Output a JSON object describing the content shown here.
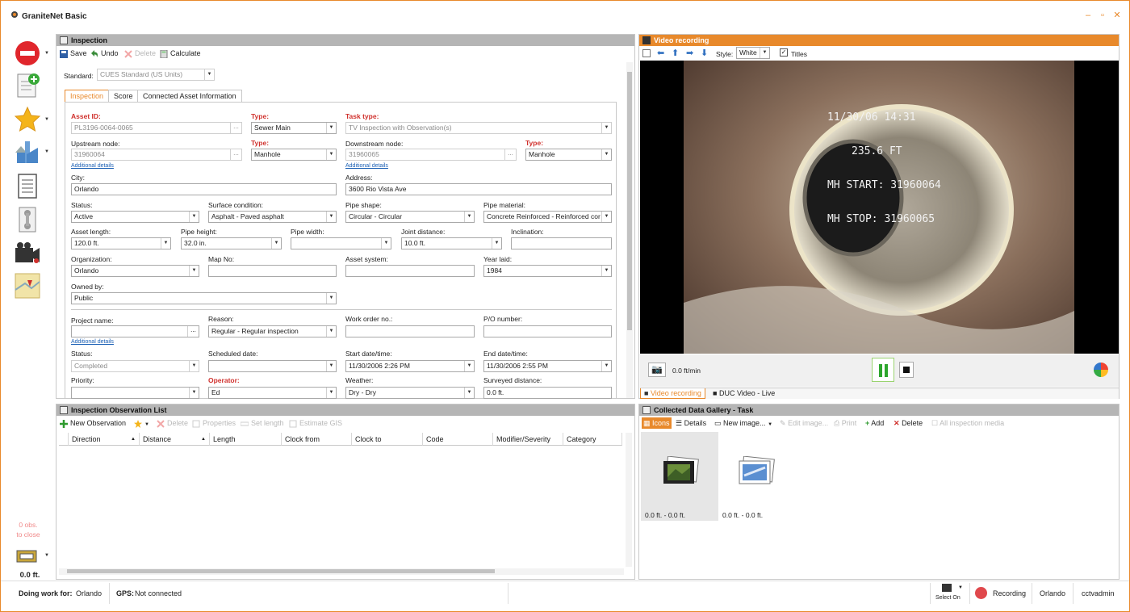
{
  "app": {
    "title": "GraniteNet Basic"
  },
  "leftbar": {
    "obs_count": "0 obs.",
    "obs_close": "to close",
    "distance": "0.0 ft."
  },
  "inspection": {
    "header": "Inspection",
    "toolbar": {
      "save": "Save",
      "undo": "Undo",
      "delete": "Delete",
      "calculate": "Calculate"
    },
    "standard_label": "Standard:",
    "standard_value": "CUES Standard (US Units)",
    "tabs": [
      "Inspection",
      "Score",
      "Connected Asset Information"
    ],
    "fields": {
      "asset_id_label": "Asset ID:",
      "asset_id": "PL3196-0064-0065",
      "type1_label": "Type:",
      "type1": "Sewer Main",
      "task_type_label": "Task type:",
      "task_type": "TV Inspection with Observation(s)",
      "upstream_label": "Upstream node:",
      "upstream": "31960064",
      "type2_label": "Type:",
      "type2": "Manhole",
      "downstream_label": "Downstream node:",
      "downstream": "31960065",
      "type3_label": "Type:",
      "type3": "Manhole",
      "additional_details": "Additional details",
      "city_label": "City:",
      "city": "Orlando",
      "address_label": "Address:",
      "address": "3600 Rio Vista Ave",
      "status_label": "Status:",
      "status": "Active",
      "surface_label": "Surface condition:",
      "surface": "Asphalt - Paved asphalt",
      "shape_label": "Pipe shape:",
      "shape": "Circular - Circular",
      "material_label": "Pipe material:",
      "material": "Concrete Reinforced - Reinforced cor",
      "length_label": "Asset length:",
      "length": "120.0 ft.",
      "height_label": "Pipe height:",
      "height": "32.0 in.",
      "width_label": "Pipe width:",
      "width": "",
      "joint_label": "Joint distance:",
      "joint": "10.0 ft.",
      "inclination_label": "Inclination:",
      "inclination": "",
      "org_label": "Organization:",
      "org": "Orlando",
      "mapno_label": "Map No:",
      "mapno": "",
      "asset_system_label": "Asset system:",
      "asset_system": "",
      "year_label": "Year laid:",
      "year": "1984",
      "owned_label": "Owned by:",
      "owned": "Public",
      "project_label": "Project name:",
      "project": "",
      "reason_label": "Reason:",
      "reason": "Regular - Regular inspection",
      "workorder_label": "Work order no.:",
      "workorder": "",
      "po_label": "P/O number:",
      "po": "",
      "status2_label": "Status:",
      "status2": "Completed",
      "scheduled_label": "Scheduled date:",
      "scheduled": "",
      "start_label": "Start date/time:",
      "start": "11/30/2006 2:26 PM",
      "end_label": "End date/time:",
      "end": "11/30/2006 2:55 PM",
      "priority_label": "Priority:",
      "priority": "",
      "operator_label": "Operator:",
      "operator": "Ed",
      "weather_label": "Weather:",
      "weather": "Dry - Dry",
      "surveyed_label": "Surveyed distance:",
      "surveyed": "0.0 ft."
    }
  },
  "observations": {
    "header": "Inspection Observation List",
    "toolbar": {
      "new": "New Observation",
      "delete": "Delete",
      "properties": "Properties",
      "set_length": "Set length",
      "estimate_gis": "Estimate GIS"
    },
    "columns": [
      "Direction",
      "Distance",
      "Length",
      "Clock from",
      "Clock to",
      "Code",
      "Modifier/Severity",
      "Category"
    ]
  },
  "video": {
    "header": "Video recording",
    "style_label": "Style:",
    "style_value": "White",
    "titles_label": "Titles",
    "overlay": [
      "11/30/06 14:31",
      "235.6 FT",
      "MH START: 31960064",
      "MH STOP: 31960065"
    ],
    "speed": "0.0 ft/min",
    "tabs": [
      "Video recording",
      "DUC Video - Live"
    ]
  },
  "gallery": {
    "header": "Collected Data Gallery - Task",
    "toolbar": {
      "icons": "Icons",
      "details": "Details",
      "new_image": "New image...",
      "edit_image": "Edit image...",
      "print": "Print",
      "add": "Add",
      "delete": "Delete",
      "all_media": "All inspection media"
    },
    "items": [
      {
        "caption": "0.0 ft. - 0.0 ft."
      },
      {
        "caption": "0.0 ft. - 0.0 ft."
      }
    ]
  },
  "status": {
    "doing_work_label": "Doing work for:",
    "doing_work": "Orlando",
    "gps_label": "GPS:",
    "gps": "Not connected",
    "select_on": "Select On",
    "recording": "Recording",
    "city": "Orlando",
    "user": "cctvadmin"
  },
  "colors": {
    "accent": "#e8892b",
    "required": "#d0312d",
    "link": "#1a5fb4"
  }
}
